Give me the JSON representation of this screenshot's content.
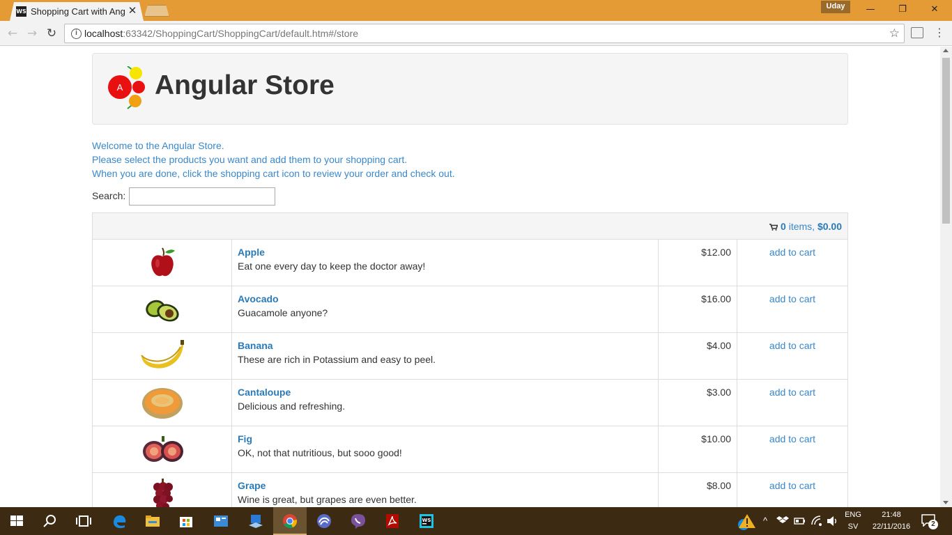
{
  "browser": {
    "tab_title": "Shopping Cart with Angu",
    "tab_favicon": "WS",
    "tab_close": "✕",
    "user_name": "Uday",
    "url_host": "localhost",
    "url_rest": ":63342/ShoppingCart/ShoppingCart/default.htm#/store",
    "back_icon": "←",
    "forward_icon": "→",
    "reload_icon": "↻",
    "star_icon": "☆",
    "menu_icon": "⋮",
    "minimize_icon": "—",
    "restore_icon": "❐",
    "close_icon": "✕"
  },
  "page": {
    "store_title": "Angular Store",
    "logo_letter": "A",
    "welcome_lines": [
      "Welcome to the Angular Store.",
      "Please select the products you want and add them to your shopping cart.",
      "When you are done, click the shopping cart icon to review your order and check out."
    ],
    "search_label": "Search:",
    "search_value": "",
    "cart": {
      "count": "0",
      "items_label": " items, ",
      "total": "$0.00"
    },
    "add_label": "add to cart",
    "products": [
      {
        "name": "Apple",
        "description": "Eat one every day to keep the doctor away!",
        "price": "$12.00",
        "image": "apple"
      },
      {
        "name": "Avocado",
        "description": "Guacamole anyone?",
        "price": "$16.00",
        "image": "avocado"
      },
      {
        "name": "Banana",
        "description": "These are rich in Potassium and easy to peel.",
        "price": "$4.00",
        "image": "banana"
      },
      {
        "name": "Cantaloupe",
        "description": "Delicious and refreshing.",
        "price": "$3.00",
        "image": "cantaloupe"
      },
      {
        "name": "Fig",
        "description": "OK, not that nutritious, but sooo good!",
        "price": "$10.00",
        "image": "fig"
      },
      {
        "name": "Grape",
        "description": "Wine is great, but grapes are even better.",
        "price": "$8.00",
        "image": "grape"
      }
    ]
  },
  "taskbar": {
    "apps": [
      "start-icon",
      "search-icon",
      "task-view-icon",
      "edge-icon",
      "file-explorer-icon",
      "store-icon",
      "app-icon",
      "app-icon-2",
      "chrome-icon",
      "browser-app-icon",
      "viber-icon",
      "acrobat-icon",
      "webstorm-icon"
    ],
    "language": "ENG",
    "region": "SV",
    "time": "21:48",
    "date": "22/11/2016",
    "notification_count": "2"
  },
  "colors": {
    "titlebar": "#e49b36",
    "link": "#3a87c9",
    "taskbar": "#3c2a12"
  }
}
